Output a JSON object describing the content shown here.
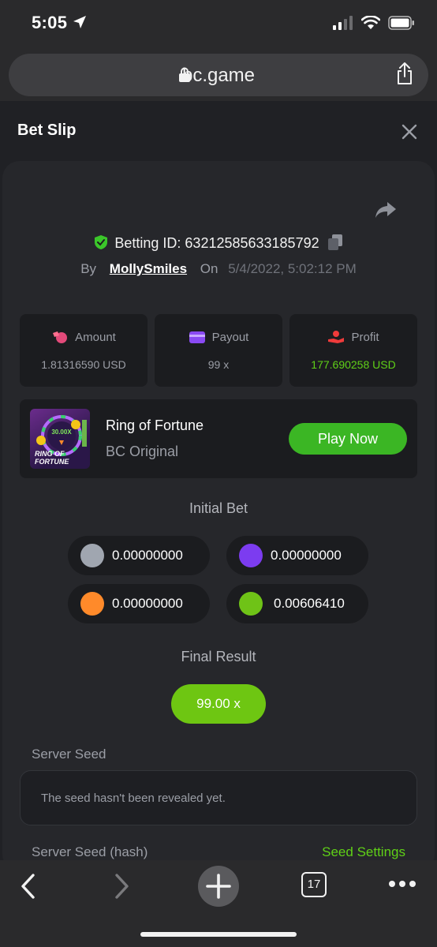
{
  "status_bar": {
    "time": "5:05"
  },
  "browser": {
    "url": "bc.game",
    "tab_count": "17"
  },
  "sheet": {
    "title": "Bet Slip",
    "betting_id_label": "Betting ID: 63212585633185792",
    "by_label": "By",
    "user": "MollySmiles",
    "on_label": "On",
    "date": "5/4/2022, 5:02:12 PM",
    "stats": {
      "amount_label": "Amount",
      "amount_value": "1.81316590 USD",
      "payout_label": "Payout",
      "payout_value": "99 x",
      "profit_label": "Profit",
      "profit_value": "177.690258 USD"
    },
    "game": {
      "name": "Ring of Fortune",
      "provider": "BC Original",
      "play_label": "Play Now",
      "thumb_multiplier": "30.00X",
      "thumb_title_1": "RING OF",
      "thumb_title_2": "FORTUNE"
    },
    "initial_bet_title": "Initial Bet",
    "initial_bets": [
      {
        "color": "#a0a6b0",
        "value": "0.00000000"
      },
      {
        "color": "#7c3cf0",
        "value": "0.00000000"
      },
      {
        "color": "#ff8a2a",
        "value": "0.00000000"
      },
      {
        "color": "#6fc317",
        "value": "0.00606410"
      }
    ],
    "final_result_title": "Final Result",
    "final_result_value": "99.00 x",
    "server_seed_label": "Server Seed",
    "server_seed_value": "The seed hasn't been revealed yet.",
    "server_seed_hash_label": "Server Seed (hash)",
    "seed_settings_label": "Seed Settings"
  },
  "colors": {
    "accent_green": "#5fd017",
    "button_green": "#3bb624"
  }
}
